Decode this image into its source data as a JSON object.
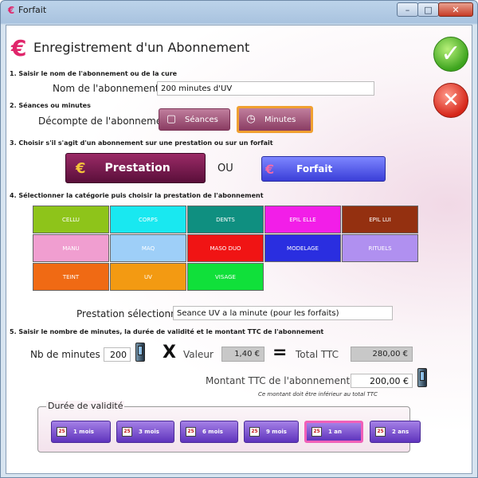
{
  "window": {
    "title": "Forfait",
    "app_icon": "€"
  },
  "header": {
    "logo": "€",
    "title": "Enregistrement d'un Abonnement"
  },
  "actions": {
    "ok_icon": "checkmark-icon",
    "cancel_icon": "x-icon"
  },
  "sec1": {
    "title": "1. Saisir le nom de l'abonnement ou de la cure",
    "label": "Nom de l'abonnement",
    "value": "200 minutes d'UV"
  },
  "sec2": {
    "title": "2. Séances ou minutes",
    "label": "Décompte de l'abonnement",
    "seances": "Séances",
    "minutes": "Minutes"
  },
  "sec3": {
    "title": "3. Choisir s'il s'agit d'un abonnement sur une prestation ou sur un forfait",
    "prestation": "Prestation",
    "ou": "OU",
    "forfait": "Forfait",
    "euro": "€"
  },
  "sec4": {
    "title": "4. Sélectionner la catégorie puis choisir la prestation de l'abonnement",
    "categories": [
      {
        "label": "CELLU",
        "color": "#8ec41a"
      },
      {
        "label": "CORPS",
        "color": "#19e8f0"
      },
      {
        "label": "DENTS",
        "color": "#0f8f80"
      },
      {
        "label": "EPIL ELLE",
        "color": "#f21ee8"
      },
      {
        "label": "EPIL LUI",
        "color": "#943010"
      },
      {
        "label": "MANU",
        "color": "#f09ed0"
      },
      {
        "label": "MAQ",
        "color": "#9ecff8"
      },
      {
        "label": "MASO DUO",
        "color": "#f01414"
      },
      {
        "label": "MODELAGE",
        "color": "#2a2ee0"
      },
      {
        "label": "RITUELS",
        "color": "#b090f0"
      },
      {
        "label": "TEINT",
        "color": "#f06a14"
      },
      {
        "label": "UV",
        "color": "#f39a12"
      },
      {
        "label": "VISAGE",
        "color": "#10e03a"
      }
    ],
    "selected_label": "Prestation sélectionnée",
    "selected_value": "Seance UV a la minute (pour les forfaits)"
  },
  "sec5": {
    "title": "5. Saisir le nombre de minutes, la durée de validité et le montant TTC de l'abonnement",
    "nb_label": "Nb de minutes",
    "nb_value": "200",
    "x": "X",
    "valeur_label": "Valeur",
    "valeur_value": "1,40 €",
    "eq": "=",
    "total_label": "Total TTC",
    "total_value": "280,00 €",
    "montant_label": "Montant TTC de l'abonnement",
    "montant_value": "200,00 €",
    "note": "Ce montant doit être inférieur au total TTC"
  },
  "duree": {
    "title": "Durée de validité",
    "cal_glyph": "25",
    "options": [
      "1 mois",
      "3 mois",
      "6 mois",
      "9 mois",
      "1 an",
      "2 ans"
    ],
    "selected": "1 an"
  }
}
